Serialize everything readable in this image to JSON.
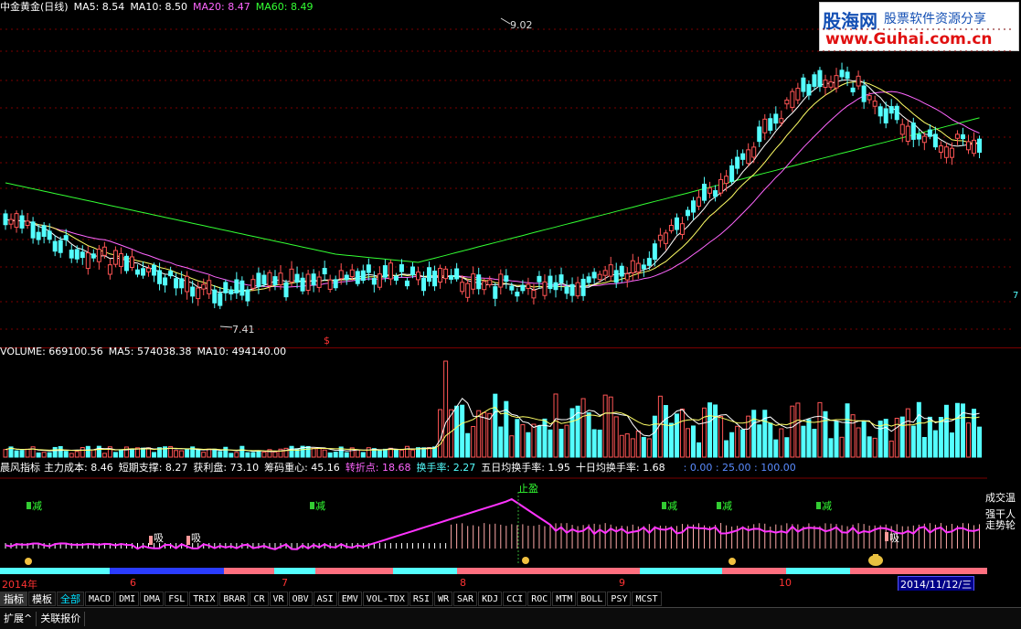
{
  "price_header": {
    "title": "中金黄金(日线)",
    "ma5": "MA5: 8.54",
    "ma10": "MA10: 8.50",
    "ma20": "MA20: 8.47",
    "ma60": "MA60: 8.49"
  },
  "annotations": {
    "high": "9.02",
    "low": "7.41",
    "dollar": "$",
    "right_mark": "7"
  },
  "volume_header": {
    "label": "VOLUME: 669100.56",
    "ma5": "MA5: 574038.38",
    "ma10": "MA10: 494140.00"
  },
  "indicator_header": {
    "name": "晨风指标",
    "cost": "主力成本: 8.46",
    "support": "短期支撑: 8.27",
    "profit": "获利盘: 73.10",
    "center": "筹码重心: 45.16",
    "turn": "转折点: 18.68",
    "turnover": "换手率: 2.27",
    "turnover5": "五日均换手率: 1.95",
    "turnover10": "十日均换手率: 1.68",
    "levels": ": 0.00  : 25.00  : 100.00"
  },
  "indicator_labels": {
    "reduce": "减",
    "absorb": "吸",
    "stop": "止盈",
    "right1": "成交温",
    "right2": "强干人",
    "right3": "走势轮"
  },
  "timeline": {
    "year": "2014年",
    "months": [
      "6",
      "7",
      "8",
      "9",
      "10"
    ],
    "current_date": "2014/11/12/三"
  },
  "tabs": [
    "指标",
    "模板",
    "全部",
    "MACD",
    "DMI",
    "DMA",
    "FSL",
    "TRIX",
    "BRAR",
    "CR",
    "VR",
    "OBV",
    "ASI",
    "EMV",
    "VOL-TDX",
    "RSI",
    "WR",
    "SAR",
    "KDJ",
    "CCI",
    "ROC",
    "MTM",
    "BOLL",
    "PSY",
    "MCST"
  ],
  "bottom_tabs": [
    "扩展^",
    "关联报价"
  ],
  "logo": {
    "line1": "股海网",
    "line2": "股票软件资源分享",
    "url": "www.Guhai.com.cn"
  },
  "colors": {
    "up": "#ff5555",
    "down": "#54ffff",
    "ma5": "#ffffff",
    "ma10": "#ffff66",
    "ma20": "#ff66ff",
    "ma60": "#33ff33",
    "grid": "#7a0000"
  }
}
